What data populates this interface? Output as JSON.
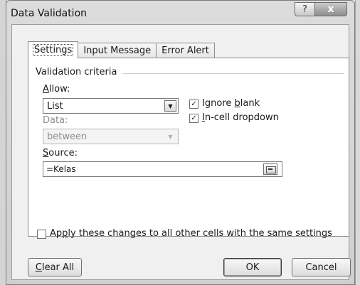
{
  "window": {
    "title": "Data Validation",
    "help_label": "?",
    "close_label": "x"
  },
  "tabs": [
    {
      "label": "Settings",
      "active": true
    },
    {
      "label": "Input Message",
      "active": false
    },
    {
      "label": "Error Alert",
      "active": false
    }
  ],
  "settings": {
    "group_label": "Validation criteria",
    "allow": {
      "label_access": "A",
      "label_rest": "llow:",
      "value": "List"
    },
    "data": {
      "label": "Data:",
      "value": "between"
    },
    "ignore_blank": {
      "label_pre": "Ignore ",
      "label_access": "b",
      "label_post": "lank",
      "checked": true
    },
    "in_cell_dropdown": {
      "label_access": "I",
      "label_rest": "n-cell dropdown",
      "checked": true
    },
    "source": {
      "label_access": "S",
      "label_rest": "ource:",
      "value": "=Kelas"
    }
  },
  "apply_all": {
    "label_pre": "Ap",
    "label_access": "p",
    "label_post": "ly these changes to all other cells with the same settings",
    "checked": false
  },
  "buttons": {
    "clear_all_access": "C",
    "clear_all_rest": "lear All",
    "ok": "OK",
    "cancel": "Cancel"
  },
  "colors": {
    "dialog_bg": "#f0f0f0",
    "panel_bg": "#ffffff",
    "border": "#8c8c8c"
  }
}
